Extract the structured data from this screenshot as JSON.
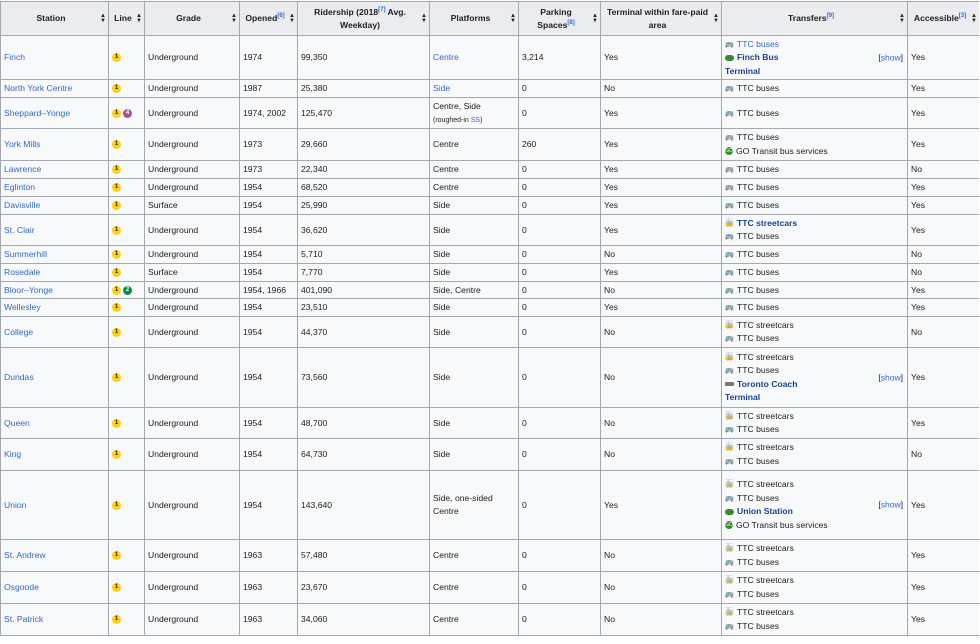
{
  "headers": {
    "station": "Station",
    "line": "Line",
    "grade": "Grade",
    "opened": "Opened",
    "opened_ref": "[6]",
    "ridership": "Ridership (2018",
    "ridership_ref": "[7]",
    "ridership_tail": " Avg. Weekday)",
    "platforms": "Platforms",
    "parking": "Parking Spaces",
    "parking_ref": "[8]",
    "terminal": "Terminal within fare-paid area",
    "transfers": "Transfers",
    "transfers_ref": "[9]",
    "accessible": "Accessible",
    "accessible_ref": "[3]"
  },
  "show_label": "show",
  "line_colors": {
    "1": "#fcd116",
    "2": "#00923f",
    "4": "#a8518a"
  },
  "rows": [
    {
      "station": "Finch",
      "lines": [
        "1"
      ],
      "grade": "Underground",
      "opened": "1974",
      "ridership": "99,350",
      "platforms": "Centre",
      "platforms_link": true,
      "parking": "3,214",
      "terminal": "Yes",
      "transfers": [
        {
          "icon": "bus",
          "text": "TTC buses",
          "link": true
        },
        {
          "icon": "gofill",
          "text": "Finch Bus",
          "bold": true
        },
        {
          "icon": "",
          "text": "Terminal",
          "bold": true
        }
      ],
      "show": true,
      "accessible": "Yes",
      "h": 44
    },
    {
      "station": "North York Centre",
      "lines": [
        "1"
      ],
      "grade": "Underground",
      "opened": "1987",
      "ridership": "25,380",
      "platforms": "Side",
      "platforms_link": true,
      "parking": "0",
      "terminal": "No",
      "transfers": [
        {
          "icon": "bus",
          "text": "TTC buses"
        }
      ],
      "accessible": "Yes",
      "h": 18
    },
    {
      "station": "Sheppard–Yonge",
      "lines": [
        "1",
        "4"
      ],
      "grade": "Underground",
      "opened": "1974, 2002",
      "ridership": "125,470",
      "platforms": "Centre, Side",
      "platforms_note": "(roughed-in ",
      "platforms_note_link": "SS",
      "platforms_note_end": ")",
      "parking": "0",
      "terminal": "Yes",
      "transfers": [
        {
          "icon": "bus",
          "text": "TTC buses"
        }
      ],
      "accessible": "Yes",
      "h": 31
    },
    {
      "station": "York Mills",
      "lines": [
        "1"
      ],
      "grade": "Underground",
      "opened": "1973",
      "ridership": "29,660",
      "platforms": "Centre",
      "parking": "260",
      "terminal": "Yes",
      "transfers": [
        {
          "icon": "bus",
          "text": "TTC buses"
        },
        {
          "icon": "go",
          "text": "GO Transit bus services"
        }
      ],
      "accessible": "Yes",
      "h": 32
    },
    {
      "station": "Lawrence",
      "lines": [
        "1"
      ],
      "grade": "Underground",
      "opened": "1973",
      "ridership": "22,340",
      "platforms": "Centre",
      "parking": "0",
      "terminal": "Yes",
      "transfers": [
        {
          "icon": "bus",
          "text": "TTC buses"
        }
      ],
      "accessible": "No",
      "h": 18
    },
    {
      "station": "Eglinton",
      "lines": [
        "1"
      ],
      "grade": "Underground",
      "opened": "1954",
      "ridership": "68,520",
      "platforms": "Centre",
      "parking": "0",
      "terminal": "Yes",
      "transfers": [
        {
          "icon": "bus",
          "text": "TTC buses"
        }
      ],
      "accessible": "Yes",
      "h": 18
    },
    {
      "station": "Davisville",
      "lines": [
        "1"
      ],
      "grade": "Surface",
      "opened": "1954",
      "ridership": "25,990",
      "platforms": "Side",
      "parking": "0",
      "terminal": "Yes",
      "transfers": [
        {
          "icon": "bus",
          "text": "TTC buses"
        }
      ],
      "accessible": "Yes",
      "h": 18
    },
    {
      "station": "St. Clair",
      "lines": [
        "1"
      ],
      "grade": "Underground",
      "opened": "1954",
      "ridership": "36,620",
      "platforms": "Side",
      "parking": "0",
      "terminal": "Yes",
      "transfers": [
        {
          "icon": "tram",
          "text": "TTC streetcars",
          "bold": true
        },
        {
          "icon": "bus",
          "text": "TTC buses"
        }
      ],
      "accessible": "Yes",
      "h": 31
    },
    {
      "station": "Summerhill",
      "lines": [
        "1"
      ],
      "grade": "Underground",
      "opened": "1954",
      "ridership": "5,710",
      "platforms": "Side",
      "parking": "0",
      "terminal": "No",
      "transfers": [
        {
          "icon": "bus",
          "text": "TTC buses"
        }
      ],
      "accessible": "No",
      "h": 18
    },
    {
      "station": "Rosedale",
      "lines": [
        "1"
      ],
      "grade": "Surface",
      "opened": "1954",
      "ridership": "7,770",
      "platforms": "Side",
      "parking": "0",
      "terminal": "Yes",
      "transfers": [
        {
          "icon": "bus",
          "text": "TTC buses"
        }
      ],
      "accessible": "No",
      "h": 18
    },
    {
      "station": "Bloor–Yonge",
      "lines": [
        "1",
        "2"
      ],
      "grade": "Underground",
      "opened": "1954, 1966",
      "ridership": "401,090",
      "platforms": "Side, Centre",
      "parking": "0",
      "terminal": "No",
      "transfers": [
        {
          "icon": "bus",
          "text": "TTC buses"
        }
      ],
      "accessible": "Yes",
      "h": 17
    },
    {
      "station": "Wellesley",
      "lines": [
        "1"
      ],
      "grade": "Underground",
      "opened": "1954",
      "ridership": "23,510",
      "platforms": "Side",
      "parking": "0",
      "terminal": "Yes",
      "transfers": [
        {
          "icon": "bus",
          "text": "TTC buses"
        }
      ],
      "accessible": "Yes",
      "h": 18
    },
    {
      "station": "College",
      "lines": [
        "1"
      ],
      "grade": "Underground",
      "opened": "1954",
      "ridership": "44,370",
      "platforms": "Side",
      "parking": "0",
      "terminal": "No",
      "transfers": [
        {
          "icon": "tram",
          "text": "TTC streetcars"
        },
        {
          "icon": "bus",
          "text": "TTC buses"
        }
      ],
      "accessible": "No",
      "h": 31
    },
    {
      "station": "Dundas",
      "lines": [
        "1"
      ],
      "grade": "Underground",
      "opened": "1954",
      "ridership": "73,560",
      "platforms": "Side",
      "parking": "0",
      "terminal": "No",
      "transfers": [
        {
          "icon": "tram",
          "text": "TTC streetcars"
        },
        {
          "icon": "bus",
          "text": "TTC buses"
        },
        {
          "icon": "coach",
          "text": "Toronto Coach",
          "bold": true
        },
        {
          "icon": "",
          "text": "Terminal",
          "bold": true
        }
      ],
      "show": true,
      "accessible": "Yes",
      "h": 60
    },
    {
      "station": "Queen",
      "lines": [
        "1"
      ],
      "grade": "Underground",
      "opened": "1954",
      "ridership": "48,700",
      "platforms": "Side",
      "parking": "0",
      "terminal": "No",
      "transfers": [
        {
          "icon": "tram",
          "text": "TTC streetcars"
        },
        {
          "icon": "bus",
          "text": "TTC buses"
        }
      ],
      "accessible": "Yes",
      "h": 31
    },
    {
      "station": "King",
      "lines": [
        "1"
      ],
      "grade": "Underground",
      "opened": "1954",
      "ridership": "64,730",
      "platforms": "Side",
      "parking": "0",
      "terminal": "No",
      "transfers": [
        {
          "icon": "tram",
          "text": "TTC streetcars"
        },
        {
          "icon": "bus",
          "text": "TTC buses"
        }
      ],
      "accessible": "No",
      "h": 32
    },
    {
      "station": "Union",
      "lines": [
        "1"
      ],
      "grade": "Underground",
      "opened": "1954",
      "ridership": "143,640",
      "platforms": "Side, one-sided",
      "platforms_line2": "Centre",
      "parking": "0",
      "terminal": "Yes",
      "transfers": [
        {
          "icon": "tram",
          "text": "TTC streetcars"
        },
        {
          "icon": "bus",
          "text": "TTC buses"
        },
        {
          "icon": "gofill",
          "text": "Union Station",
          "bold": true
        },
        {
          "icon": "go",
          "text": "GO Transit bus services"
        }
      ],
      "show": true,
      "accessible": "Yes",
      "h": 69
    },
    {
      "station": "St. Andrew",
      "lines": [
        "1"
      ],
      "grade": "Underground",
      "opened": "1963",
      "ridership": "57,480",
      "platforms": "Centre",
      "parking": "0",
      "terminal": "No",
      "transfers": [
        {
          "icon": "tram",
          "text": "TTC streetcars"
        },
        {
          "icon": "bus",
          "text": "TTC buses"
        }
      ],
      "accessible": "Yes",
      "h": 32
    },
    {
      "station": "Osgoode",
      "lines": [
        "1"
      ],
      "grade": "Underground",
      "opened": "1963",
      "ridership": "23,670",
      "platforms": "Centre",
      "parking": "0",
      "terminal": "No",
      "transfers": [
        {
          "icon": "tram",
          "text": "TTC streetcars"
        },
        {
          "icon": "bus",
          "text": "TTC buses"
        }
      ],
      "accessible": "Yes",
      "h": 32
    },
    {
      "station": "St. Patrick",
      "lines": [
        "1"
      ],
      "grade": "Underground",
      "opened": "1963",
      "ridership": "34,060",
      "platforms": "Centre",
      "parking": "0",
      "terminal": "No",
      "transfers": [
        {
          "icon": "tram",
          "text": "TTC streetcars"
        },
        {
          "icon": "bus",
          "text": "TTC buses"
        }
      ],
      "accessible": "Yes",
      "h": 32
    }
  ]
}
